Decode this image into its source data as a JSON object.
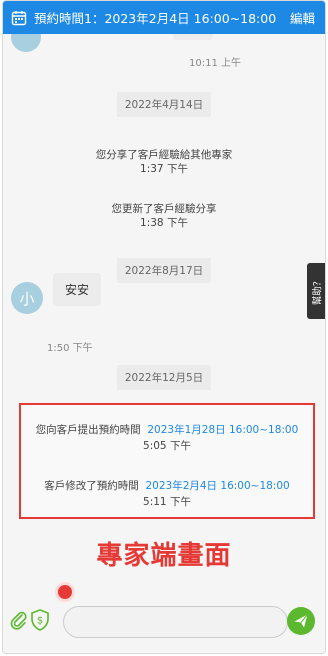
{
  "header": {
    "appointment_title": "預約時間1：2023年2月4日 16:00~18:00",
    "edit_label": "編輯"
  },
  "chat": {
    "first_time": "10:11 上午",
    "date_1": "2022年4月14日",
    "notice_1_text": "您分享了客戶經驗給其他專家",
    "notice_1_time": "1:37 下午",
    "notice_2_text": "您更新了客戶經驗分享",
    "notice_2_time": "1:38 下午",
    "date_2": "2022年8月17日",
    "avatar_initial": "小",
    "message_text": "安安",
    "message_time": "1:50 下午",
    "date_3": "2022年12月5日",
    "appt_1_prefix": "您向客戶提出預約時間",
    "appt_1_time": "2023年1月28日 16:00~18:00",
    "appt_1_sent": "5:05 下午",
    "appt_2_prefix": "客戶修改了預約時間",
    "appt_2_time": "2023年2月4日 16:00~18:00",
    "appt_2_sent": "5:11 下午",
    "annotation": "專家端畫面"
  },
  "help_tab": {
    "label": "幫助？"
  },
  "composer": {
    "placeholder": ""
  },
  "colors": {
    "header_bg": "#1e88e5",
    "link_blue": "#1e88e5",
    "highlight_red": "#e53935",
    "send_green": "#5cb82e",
    "avatar_bg": "#a8cfe0"
  },
  "icons": {
    "calendar": "calendar-icon",
    "attachment": "paperclip-icon",
    "payment": "shield-dollar-icon",
    "record": "record-dot-icon",
    "send": "paper-plane-icon"
  }
}
